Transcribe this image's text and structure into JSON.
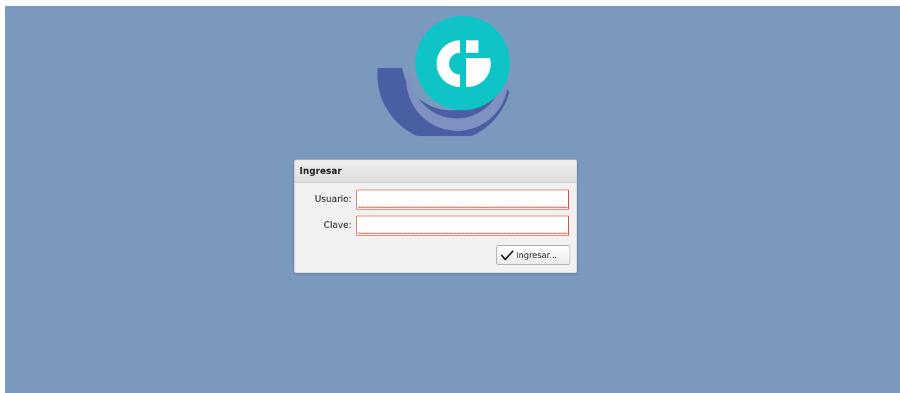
{
  "logo": {
    "icon": "g-logo-icon",
    "colors": {
      "teal": "#0fc4c7",
      "navy": "#4a5fa3",
      "white": "#ffffff"
    }
  },
  "login": {
    "title": "Ingresar",
    "usuario_label": "Usuario:",
    "usuario_value": "",
    "clave_label": "Clave:",
    "clave_value": "",
    "submit_label": "Ingresar...",
    "submit_icon": "checkmark-icon"
  },
  "colors": {
    "background": "#7b99bd",
    "invalid_border": "#d53a1e",
    "panel": "#f1f1f1"
  }
}
